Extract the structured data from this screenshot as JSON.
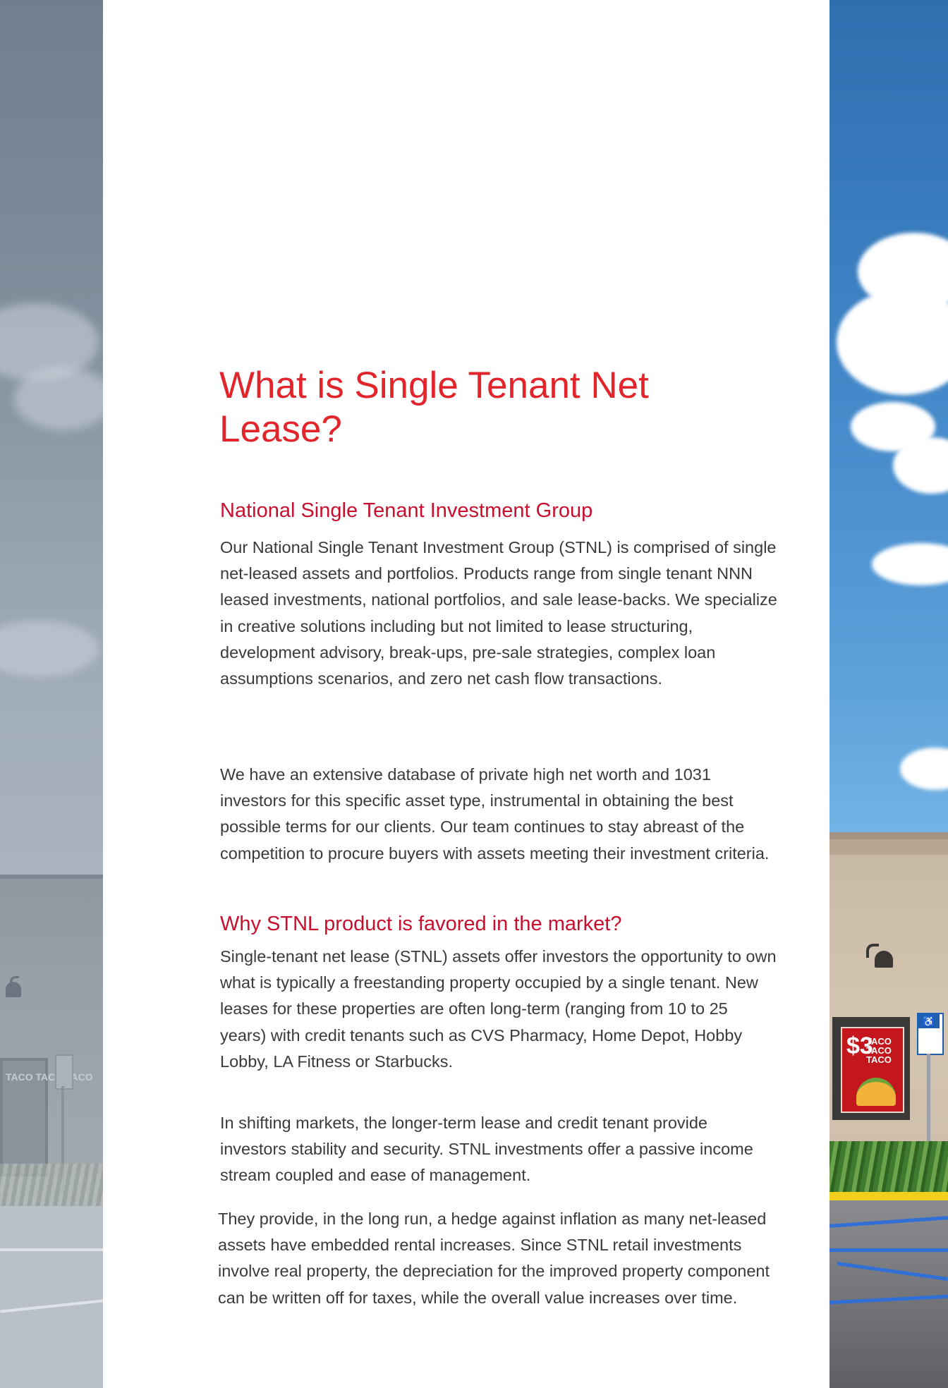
{
  "page": {
    "title": "What is Single Tenant Net Lease?"
  },
  "sections": [
    {
      "heading": "National Single Tenant Investment Group",
      "paragraphs": [
        "Our National Single Tenant Investment Group (STNL) is comprised of single net-leased assets and portfolios. Products range from single tenant NNN leased investments, national portfolios, and sale lease-backs. We specialize in creative solutions including but not limited to lease structuring, development advisory, break-ups, pre-sale strategies, complex loan assumptions scenarios, and zero net cash flow transactions.",
        "We have an extensive database of private high net worth and 1031 investors for this specific asset type, instrumental in obtaining the best possible terms for our clients. Our team continues to stay abreast of the competition to procure buyers with assets meeting their investment criteria."
      ]
    },
    {
      "heading": "Why STNL product is favored in the market?",
      "paragraphs": [
        "Single-tenant net lease (STNL) assets offer investors the opportunity to own what is typically a freestanding property occupied by a single tenant. New leases for these properties are often long-term (ranging from 10 to 25 years) with credit tenants such as CVS Pharmacy, Home Depot, Hobby Lobby, LA Fitness or Starbucks.",
        "In shifting markets, the longer-term lease and credit tenant provide investors stability and security. STNL investments offer a passive income stream coupled and ease of management.",
        "They provide, in the long run, a hedge against inflation as many net-leased assets have embedded rental increases. Since STNL retail investments involve real property, the depreciation for the improved property component can be written off for taxes, while the overall value increases over time."
      ]
    }
  ],
  "photo": {
    "poster_price": "$3",
    "poster_text": "TACO TACO TACO"
  },
  "colors": {
    "title": "#e2242b",
    "heading": "#c8102e",
    "body_text": "#3a3a3a",
    "sky": "#4b90cf"
  }
}
